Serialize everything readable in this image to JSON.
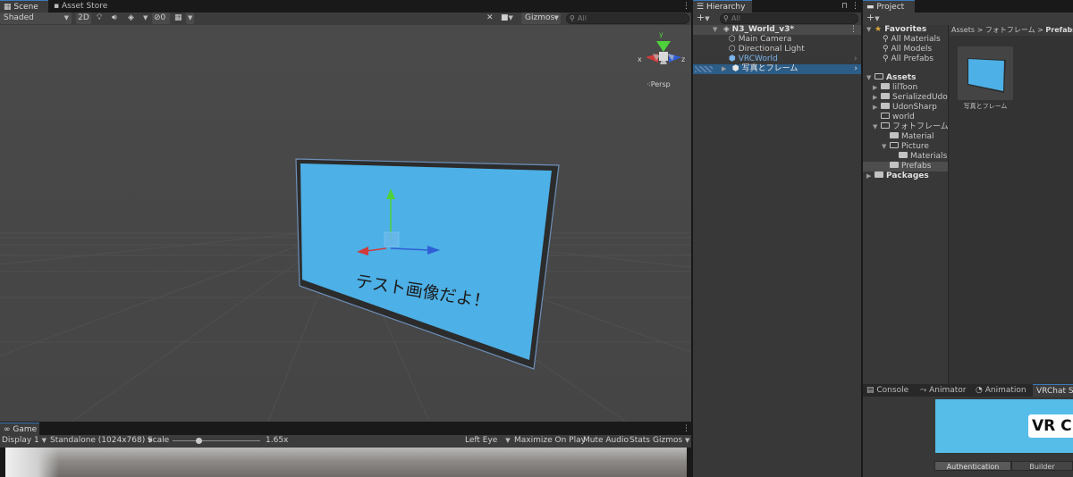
{
  "scene_tabs": {
    "scene": "Scene",
    "asset_store": "Asset Store"
  },
  "scene_toolbar": {
    "shading": "Shaded",
    "mode_2d": "2D",
    "hidden_count": "0",
    "gizmos": "Gizmos",
    "search_placeholder": "All"
  },
  "scene_view": {
    "axis_y": "y",
    "axis_x": "x",
    "axis_z": "z",
    "projection": "Persp",
    "frame_text": "テスト画像だよ！",
    "colors": {
      "background": "#464646",
      "panel": "#4db0e6",
      "frame": "#2c2c2c",
      "x_axis": "#d13b3b",
      "y_axis": "#4fd13b",
      "z_axis": "#2f5fd6"
    }
  },
  "game": {
    "tab": "Game",
    "display": "Display 1",
    "resolution": "Standalone (1024x768)",
    "scale_label": "Scale",
    "scale_value": "1.65x",
    "scale_level": 0.3,
    "eye": "Left Eye",
    "maximize": "Maximize On Play",
    "mute": "Mute Audio",
    "stats": "Stats",
    "gizmos": "Gizmos"
  },
  "hierarchy": {
    "tab": "Hierarchy",
    "search_placeholder": "All",
    "scene_name": "N3_World_v3*",
    "items": [
      {
        "label": "Main Camera",
        "icon": "cube-outline-icon"
      },
      {
        "label": "Directional Light",
        "icon": "cube-outline-icon"
      },
      {
        "label": "VRCWorld",
        "icon": "prefab-cube-icon"
      },
      {
        "label": "写真とフレーム",
        "icon": "prefab-cube-icon"
      }
    ]
  },
  "project": {
    "tab": "Project",
    "favorites_label": "Favorites",
    "favorites": [
      "All Materials",
      "All Models",
      "All Prefabs"
    ],
    "assets_label": "Assets",
    "assets": [
      {
        "label": "lilToon",
        "depth": 1,
        "expandable": true,
        "open": false
      },
      {
        "label": "SerializedUdonI",
        "depth": 1,
        "expandable": true,
        "open": false
      },
      {
        "label": "UdonSharp",
        "depth": 1,
        "expandable": true,
        "open": false
      },
      {
        "label": "world",
        "depth": 1,
        "expandable": false,
        "open": false
      },
      {
        "label": "フォトフレーム",
        "depth": 1,
        "expandable": true,
        "open": true
      },
      {
        "label": "Material",
        "depth": 2,
        "expandable": false,
        "open": false
      },
      {
        "label": "Picture",
        "depth": 2,
        "expandable": true,
        "open": true
      },
      {
        "label": "Materials",
        "depth": 3,
        "expandable": false,
        "open": false
      },
      {
        "label": "Prefabs",
        "depth": 2,
        "expandable": false,
        "open": false
      }
    ],
    "packages_label": "Packages",
    "breadcrumb": [
      "Assets",
      "フォトフレーム",
      "Prefabs"
    ],
    "asset_item": "写真とフレーム"
  },
  "bottom_tabs": {
    "console": "Console",
    "animator": "Animator",
    "animation": "Animation",
    "vrchat": "VRChat SI"
  },
  "vrchat_panel": {
    "logo": "VR C",
    "tab_auth": "Authentication",
    "tab_builder": "Builder"
  }
}
